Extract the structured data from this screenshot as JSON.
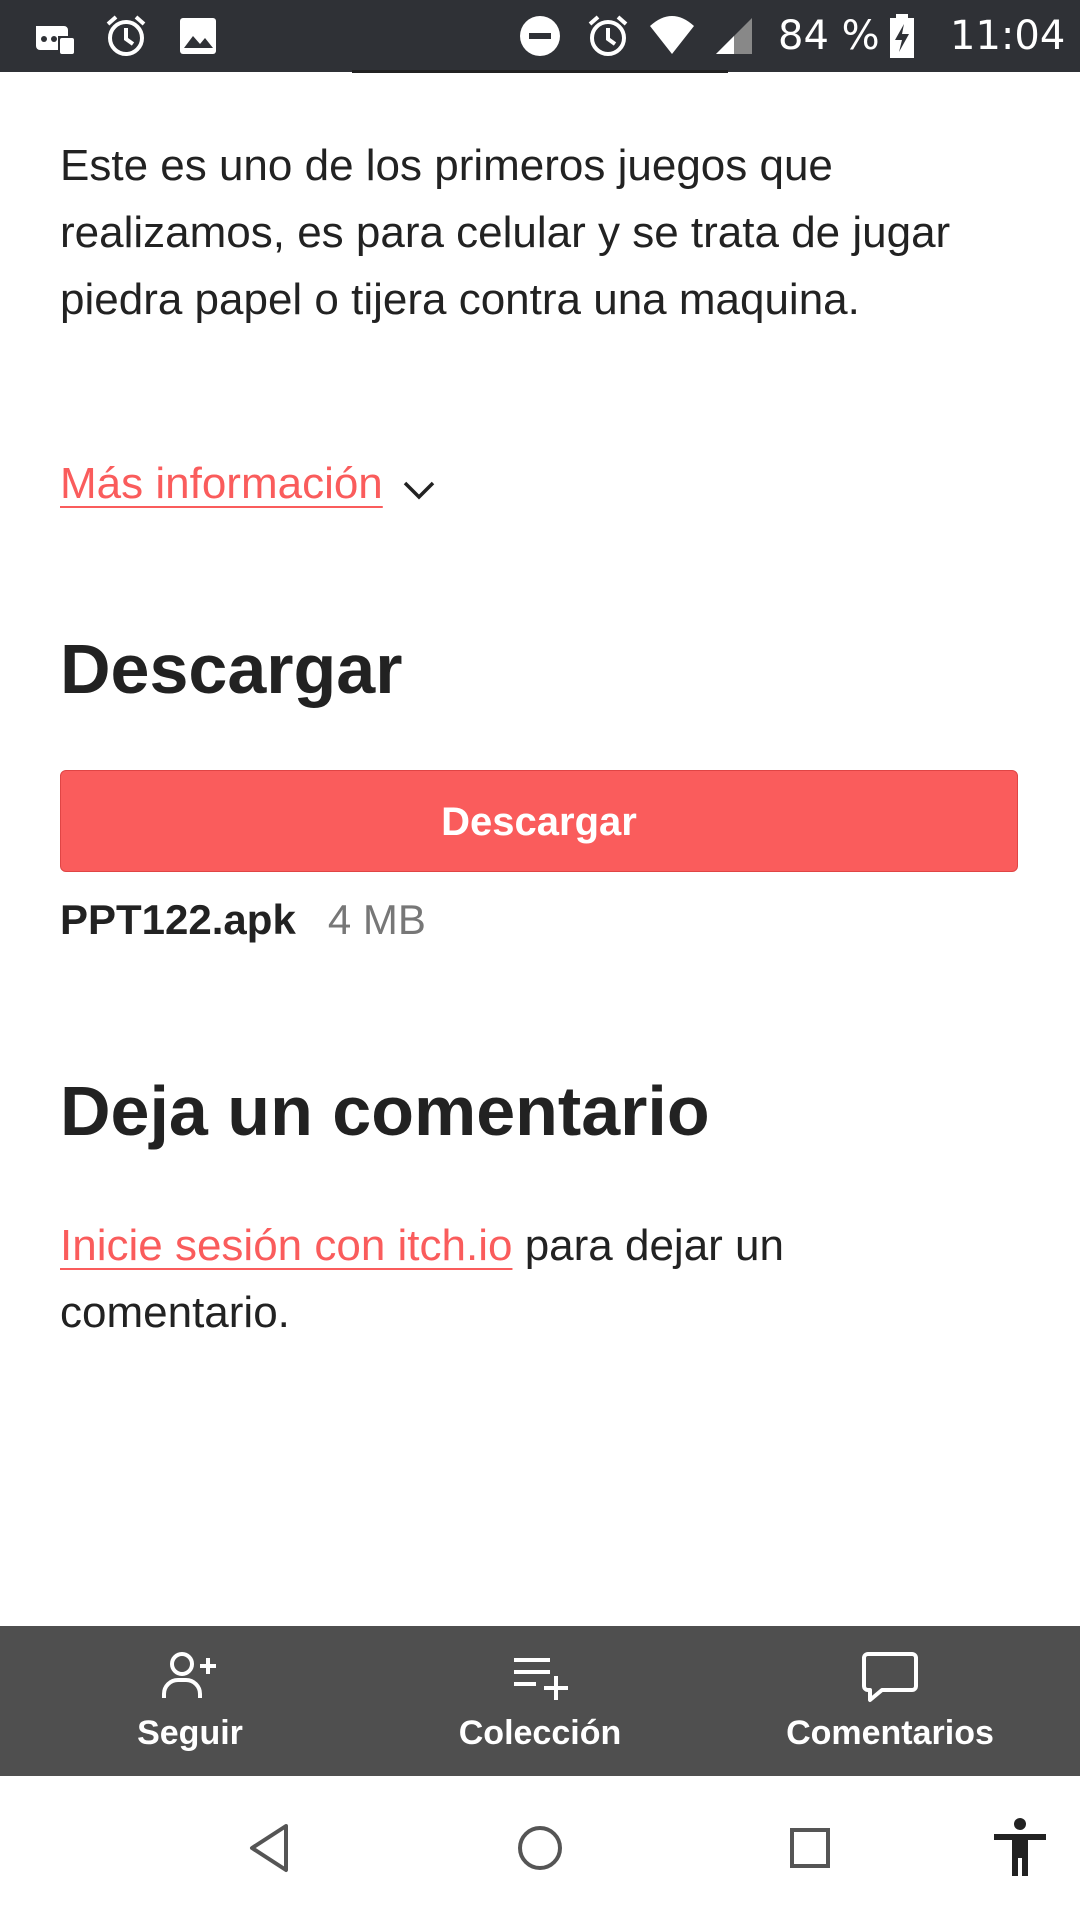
{
  "status_bar": {
    "battery_percent": "84 %",
    "time": "11:04",
    "icons": [
      "discord-icon",
      "alarm-icon",
      "image-icon",
      "do-not-disturb-icon",
      "alarm-icon",
      "wifi-icon",
      "signal-icon",
      "battery-charging-icon"
    ]
  },
  "game": {
    "description": "Este es uno de los primeros juegos que realizamos, es para celular y se trata de jugar piedra papel o tijera contra una maquina.",
    "more_info_label": "Más información"
  },
  "download": {
    "heading": "Descargar",
    "button_label": "Descargar",
    "file_name": "PPT122.apk",
    "file_size": "4 MB"
  },
  "comments": {
    "heading": "Deja un comentario",
    "login_link": "Inicie sesión con itch.io",
    "login_suffix": " para dejar un comentario."
  },
  "action_bar": {
    "follow_label": "Seguir",
    "collection_label": "Colección",
    "comments_label": "Comentarios"
  },
  "colors": {
    "accent": "#fa5c5c",
    "status_bar": "#2f3136",
    "action_bar": "#4f4f4f"
  }
}
